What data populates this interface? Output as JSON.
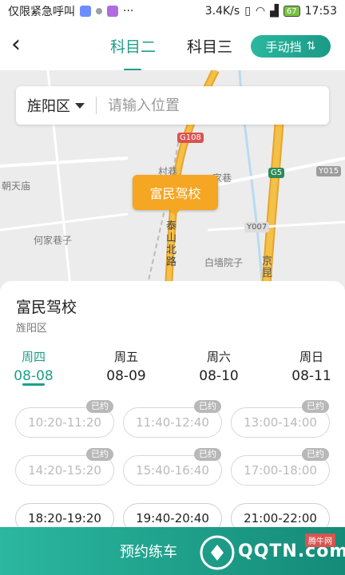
{
  "status_bar": {
    "carrier": "仅限紧急呼叫",
    "speed": "3.4K/s",
    "battery": "67",
    "time": "17:53"
  },
  "header": {
    "tabs": [
      "科目二",
      "科目三"
    ],
    "gear_label": "手动挡"
  },
  "search": {
    "district": "旌阳区",
    "placeholder": "请输入位置"
  },
  "map": {
    "labels": [
      "朝天庙",
      "何家巷子",
      "白墙院子",
      "泰山北路",
      "京昆",
      "村巷",
      "家巷",
      "京"
    ],
    "shields": [
      "G108",
      "G5",
      "Y015",
      "Y007"
    ],
    "marker": "富民驾校"
  },
  "school": {
    "name": "富民驾校",
    "district": "旌阳区"
  },
  "days": [
    {
      "weekday": "周四",
      "date": "08-08"
    },
    {
      "weekday": "周五",
      "date": "08-09"
    },
    {
      "weekday": "周六",
      "date": "08-10"
    },
    {
      "weekday": "周日",
      "date": "08-11"
    }
  ],
  "slots": [
    {
      "time": "10:20-11:20",
      "badge": "已约"
    },
    {
      "time": "11:40-12:40",
      "badge": "已约"
    },
    {
      "time": "13:00-14:00",
      "badge": "已约"
    },
    {
      "time": "14:20-15:20",
      "badge": "已约"
    },
    {
      "time": "15:40-16:40",
      "badge": "已约"
    },
    {
      "time": "17:00-18:00",
      "badge": "已约"
    },
    {
      "time": "18:20-19:20",
      "badge": ""
    },
    {
      "time": "19:40-20:40",
      "badge": ""
    },
    {
      "time": "21:00-22:00",
      "badge": ""
    }
  ],
  "footer": {
    "button": "预约练车"
  },
  "watermark": {
    "brand": "QQTN.com",
    "tag": "腾牛网"
  },
  "colors": {
    "accent": "#1f9e8a",
    "marker": "#f5a623",
    "highway": "#f2b233"
  }
}
